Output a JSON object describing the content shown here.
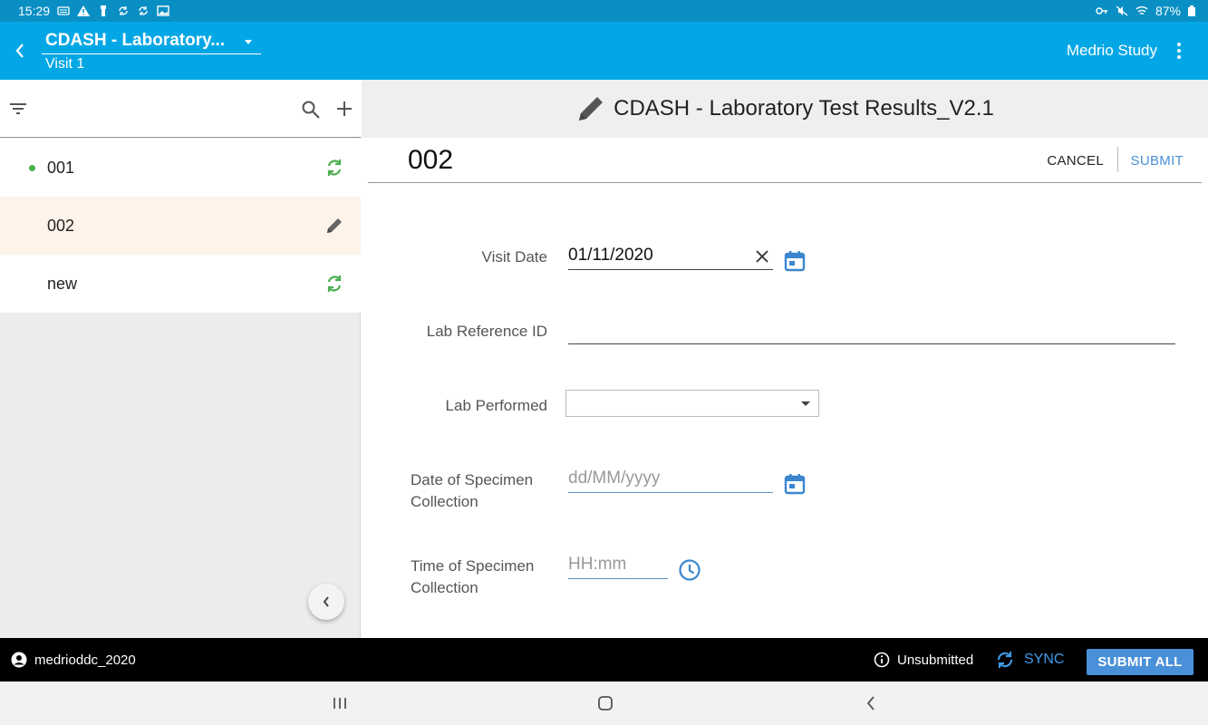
{
  "status_bar": {
    "time": "15:29",
    "battery": "87%"
  },
  "app_bar": {
    "form_title": "CDASH - Laboratory...",
    "visit": "Visit 1",
    "study_name": "Medrio Study"
  },
  "records": [
    {
      "label": "001",
      "status_icon": "sync-icon"
    },
    {
      "label": "002",
      "status_icon": "pencil-icon"
    },
    {
      "label": "new",
      "status_icon": "sync-icon"
    }
  ],
  "form": {
    "title": "CDASH - Laboratory Test Results_V2.1",
    "record_id": "002",
    "cancel_label": "CANCEL",
    "submit_label": "SUBMIT",
    "fields": {
      "visit_date": {
        "label": "Visit Date",
        "value": "01/11/2020"
      },
      "lab_reference_id": {
        "label": "Lab Reference ID",
        "value": ""
      },
      "lab_performed": {
        "label": "Lab Performed",
        "value": ""
      },
      "specimen_date": {
        "label_line1": "Date of Specimen",
        "label_line2": "Collection",
        "placeholder": "dd/MM/yyyy"
      },
      "specimen_time": {
        "label_line1": "Time of Specimen",
        "label_line2": "Collection",
        "placeholder": "HH:mm"
      }
    }
  },
  "bottom_bar": {
    "username": "medrioddc_2020",
    "status": "Unsubmitted",
    "sync_label": "SYNC",
    "submit_all_label": "SUBMIT ALL"
  },
  "colors": {
    "status_bar": "#0a8fc4",
    "app_bar": "#04a7e6",
    "accent_blue": "#4a90d9",
    "sync_green": "#4caf50",
    "active_row": "#fdf3e9"
  }
}
